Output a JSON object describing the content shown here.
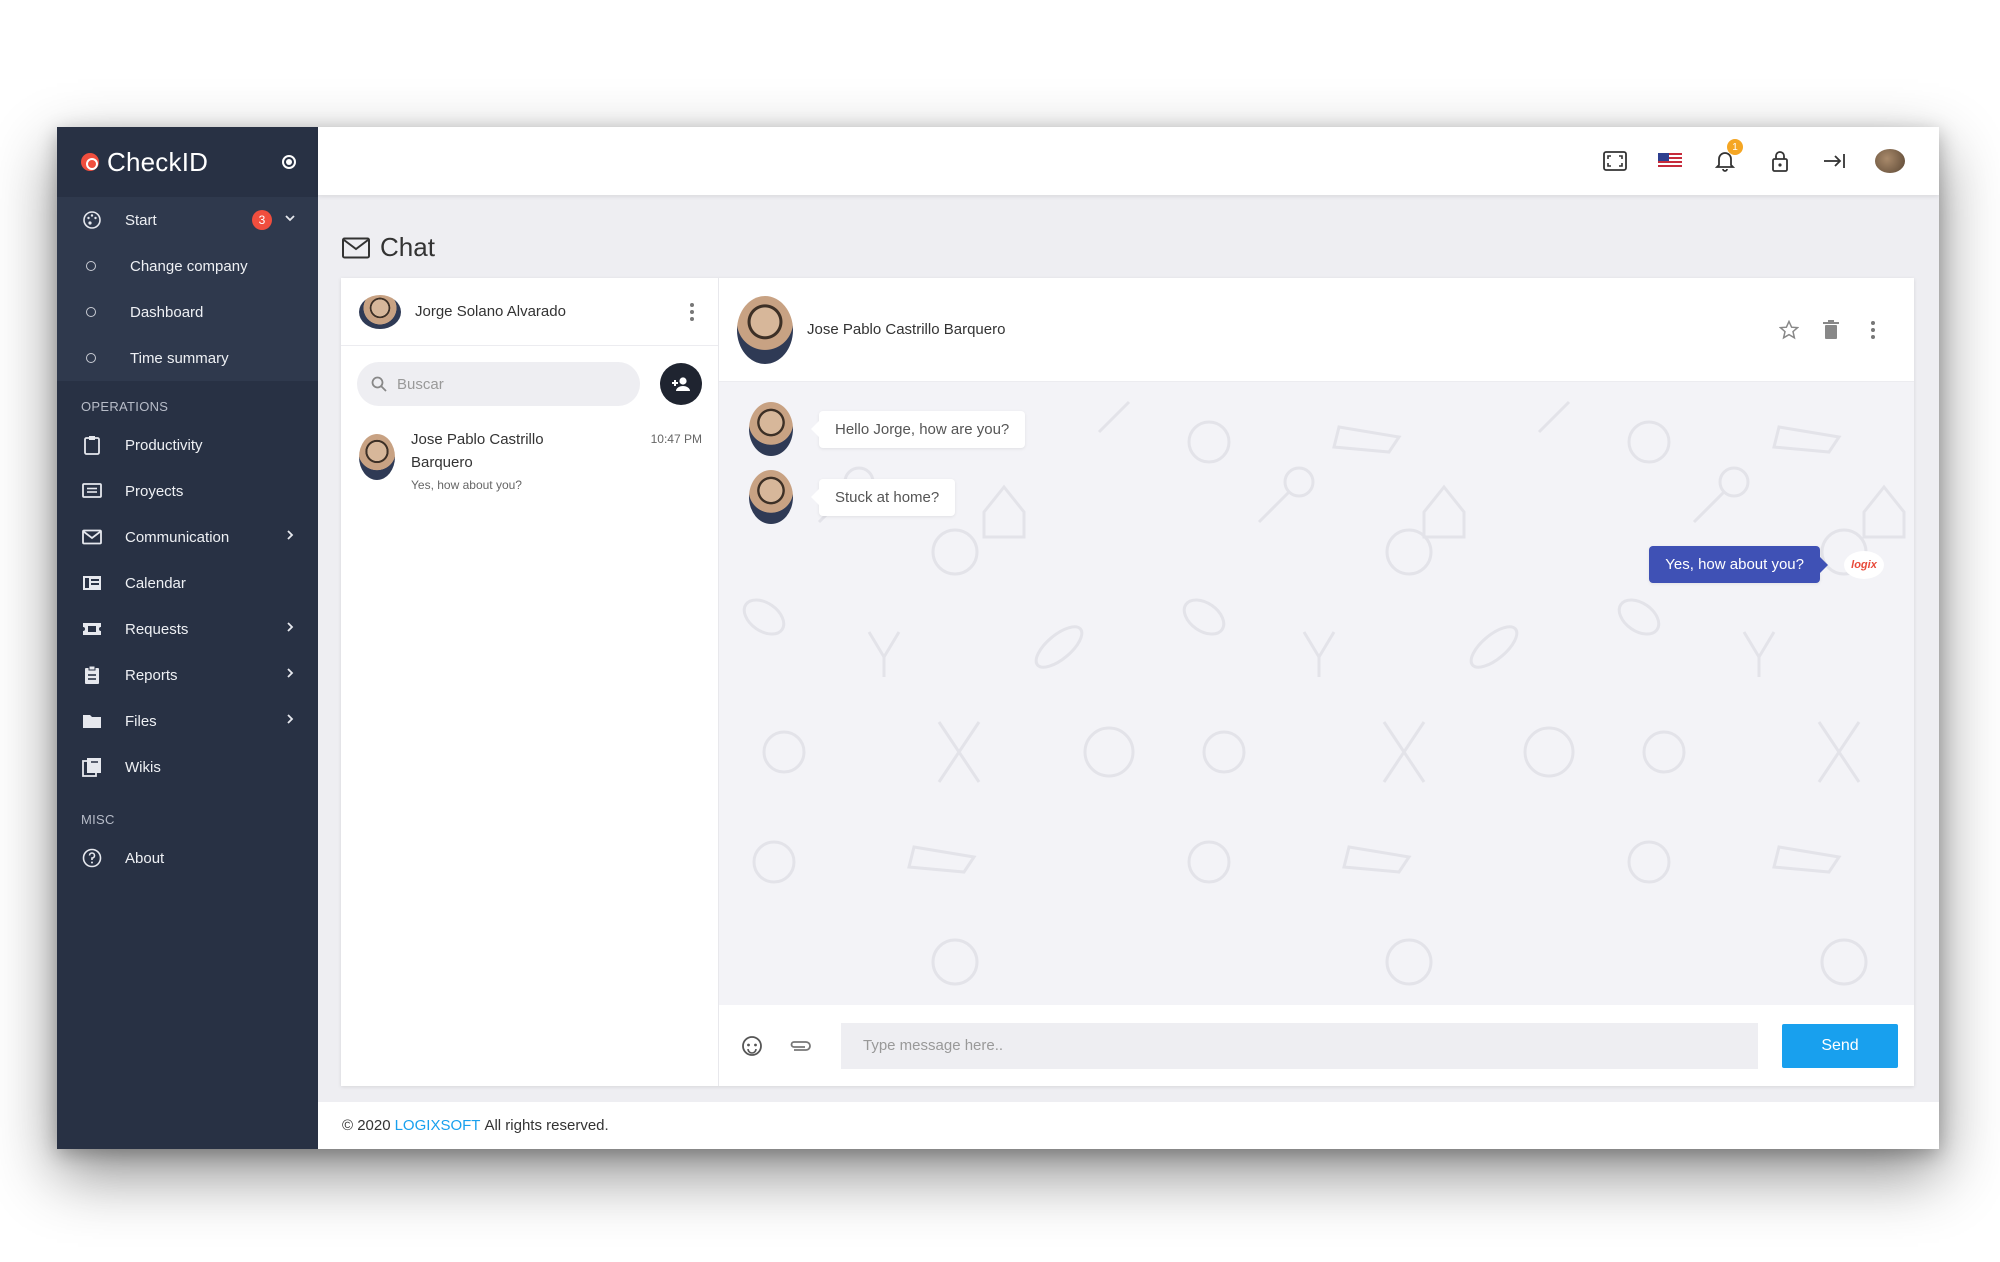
{
  "app": {
    "name": "CheckID"
  },
  "sidebar": {
    "start": {
      "label": "Start",
      "badge": "3"
    },
    "start_items": [
      {
        "label": "Change company"
      },
      {
        "label": "Dashboard"
      },
      {
        "label": "Time summary"
      }
    ],
    "operations_title": "OPERATIONS",
    "operations": [
      {
        "label": "Productivity",
        "icon": "clipboard-icon"
      },
      {
        "label": "Proyects",
        "icon": "project-icon"
      },
      {
        "label": "Communication",
        "icon": "mail-icon"
      },
      {
        "label": "Calendar",
        "icon": "calendar-icon"
      },
      {
        "label": "Requests",
        "icon": "ticket-icon"
      },
      {
        "label": "Reports",
        "icon": "report-icon"
      },
      {
        "label": "Files",
        "icon": "folder-icon"
      },
      {
        "label": "Wikis",
        "icon": "wiki-icon"
      }
    ],
    "misc_title": "MISC",
    "about": {
      "label": "About",
      "icon": "help-icon"
    }
  },
  "topbar": {
    "icons": [
      "fullscreen-icon",
      "us-flag-icon",
      "bell-icon",
      "lock-icon",
      "logout-icon",
      "avatar"
    ],
    "notification_count": "1"
  },
  "page": {
    "title": "Chat"
  },
  "chat": {
    "me": {
      "name": "Jorge Solano Alvarado"
    },
    "search_placeholder": "Buscar",
    "conversations": [
      {
        "name": "Jose Pablo Castrillo Barquero",
        "last_message": "Yes, how about you?",
        "time": "10:47 PM"
      }
    ],
    "active": {
      "name": "Jose Pablo Castrillo Barquero"
    },
    "messages": [
      {
        "direction": "in",
        "text": "Hello Jorge, how are you?"
      },
      {
        "direction": "in",
        "text": "Stuck at home?"
      },
      {
        "direction": "out",
        "text": "Yes, how about you?",
        "avatar_text": "logix"
      }
    ],
    "composer": {
      "placeholder": "Type message here..",
      "send_label": "Send"
    }
  },
  "footer": {
    "prefix": "© 2020",
    "company": "LOGIXSOFT",
    "suffix": "All rights reserved."
  },
  "colors": {
    "sidebar": "#283144",
    "accent": "#18a0ee",
    "outgoing_bubble": "#3f51b5",
    "badge": "#f04e3e"
  }
}
